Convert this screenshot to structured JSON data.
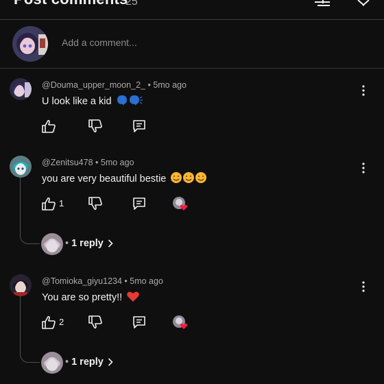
{
  "header": {
    "title": "Post comments",
    "count": "25"
  },
  "composer": {
    "placeholder": "Add a comment..."
  },
  "comments": [
    {
      "author": "@Douma_upper_moon_2_",
      "age": "5mo ago",
      "text": "U look like a kid",
      "text_emoji": "🗣🗣",
      "likes": "",
      "has_replies": false
    },
    {
      "author": "@Zenitsu478",
      "age": "5mo ago",
      "text": "you are very beautiful bestie",
      "text_emoji": "🥰🥰🥰",
      "likes": "1",
      "has_replies": true,
      "replies_label": "1 reply"
    },
    {
      "author": "@Tomioka_giyu1234",
      "age": "5mo ago",
      "text": "You are so pretty!!",
      "text_emoji": "❤️",
      "likes": "2",
      "has_replies": true,
      "replies_label": "1 reply"
    }
  ],
  "colors": {
    "background": "#0f0f0f",
    "text": "#f1f1f1",
    "muted": "#aaaaaa",
    "divider": "#3a3a3a",
    "heart": "#ff1744"
  },
  "icons": [
    "filter-icon",
    "close-icon",
    "like-icon",
    "dislike-icon",
    "reply-icon",
    "more-vert-icon",
    "creator-heart-icon",
    "chevron-right-icon"
  ]
}
